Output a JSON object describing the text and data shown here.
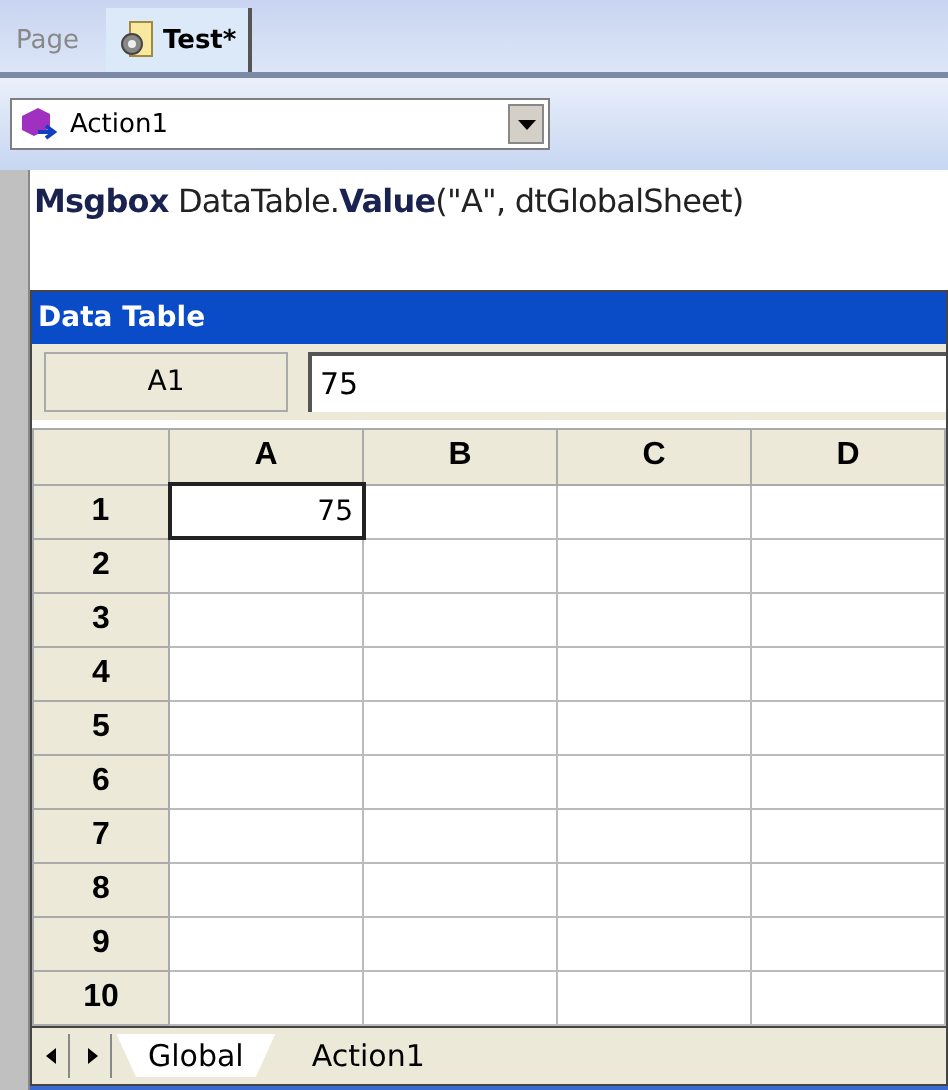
{
  "document_tabs": [
    {
      "label": "Page",
      "selected": false,
      "kind": "plain"
    },
    {
      "label": "Test*",
      "selected": true,
      "kind": "document"
    }
  ],
  "action_selector": {
    "value": "Action1"
  },
  "code_line": "**Msgbox** DataTable.**Value**(\"A\", dtGlobalSheet)",
  "data_table": {
    "title": "Data Table",
    "cell_reference": "A1",
    "formula_value": "75",
    "columns": [
      "A",
      "B",
      "C",
      "D"
    ],
    "rows": [
      {
        "header": "1",
        "cells": [
          {
            "value": "75",
            "selected": true
          },
          {
            "selected": false
          },
          {
            "selected": false
          },
          {
            "selected": false
          }
        ]
      },
      {
        "header": "2",
        "cells": []
      },
      {
        "header": "3",
        "cells": []
      },
      {
        "header": "4",
        "cells": []
      },
      {
        "header": "5",
        "cells": []
      },
      {
        "header": "6",
        "cells": []
      },
      {
        "header": "7",
        "cells": []
      },
      {
        "header": "8",
        "cells": []
      },
      {
        "header": "9",
        "cells": []
      },
      {
        "header": "10",
        "cells": []
      }
    ],
    "sheet_tabs": [
      {
        "label": "Global",
        "selected": true
      },
      {
        "label": "Action1",
        "selected": false
      }
    ]
  }
}
